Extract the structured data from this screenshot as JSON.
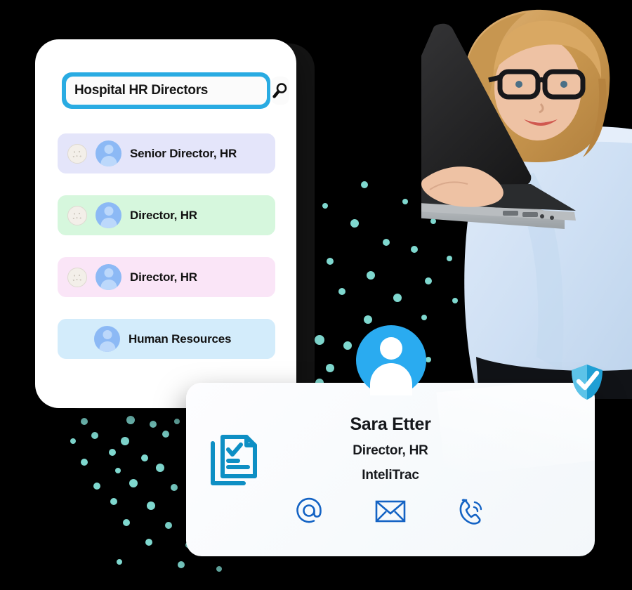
{
  "search": {
    "value": "Hospital HR Directors",
    "placeholder": "Search",
    "button_icon": "search-icon",
    "bar_color": "#29abe2"
  },
  "results": {
    "items": [
      {
        "label": "Senior Director, HR",
        "bg": "#e4e5fa",
        "has_radio": true,
        "avatar_icon": "person-avatar-icon"
      },
      {
        "label": "Director, HR",
        "bg": "#d6f7dd",
        "has_radio": true,
        "avatar_icon": "person-avatar-icon"
      },
      {
        "label": "Director, HR",
        "bg": "#fae5f7",
        "has_radio": true,
        "avatar_icon": "person-avatar-icon"
      },
      {
        "label": "Human Resources",
        "bg": "#d3ecfb",
        "has_radio": false,
        "avatar_icon": "person-avatar-icon"
      }
    ]
  },
  "profile_card": {
    "avatar_icon": "person-avatar-icon",
    "verified_icon": "shield-check-icon",
    "document_icon": "document-check-icon",
    "name": "Sara Etter",
    "title": "Director, HR",
    "company": "InteliTrac",
    "contacts": [
      {
        "icon": "at-sign-icon",
        "name": "email-handle"
      },
      {
        "icon": "envelope-icon",
        "name": "email"
      },
      {
        "icon": "phone-icon",
        "name": "phone"
      }
    ]
  },
  "theme": {
    "accent_blue": "#29abe2",
    "avatar_blue": "#2aabf0",
    "icon_blue": "#1463c4",
    "doc_blue": "#0e8fc4",
    "dot_teal": "#7fd8cf",
    "background": "#000000"
  },
  "photo": {
    "alt": "Businesswoman with glasses holding an open laptop"
  }
}
